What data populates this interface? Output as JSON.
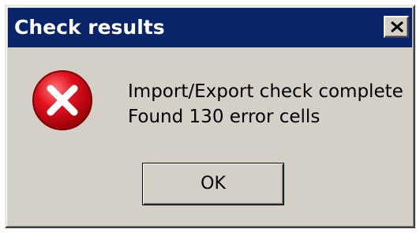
{
  "window": {
    "title": "Check results"
  },
  "icons": {
    "close": "close-icon",
    "error": "error-icon"
  },
  "message": {
    "line1": "Import/Export check complete",
    "line2": "Found 130 error cells"
  },
  "buttons": {
    "ok_label": "OK"
  },
  "colors": {
    "titlebar": "#0a246a",
    "dialog_face": "#d4d0c8",
    "error_red": "#e0101e"
  }
}
